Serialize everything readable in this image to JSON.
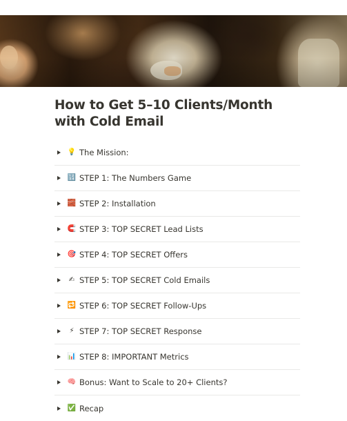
{
  "page": {
    "title": "How to Get 5–10 Clients/Month with Cold Email"
  },
  "colors": {
    "text": "#37352f",
    "divider": "#e9e9e7",
    "blue_box": "#3a78c9",
    "teal_box": "#2e8fd1",
    "green_box": "#3aa757",
    "bar_box": "#3a78c9"
  },
  "toggles": [
    {
      "icon": "lightbulb-icon",
      "glyph": "💡",
      "label": "The Mission:"
    },
    {
      "icon": "numbers-icon",
      "glyph": "🔢",
      "label": "STEP 1: The Numbers Game"
    },
    {
      "icon": "brick-icon",
      "glyph": "🧱",
      "label": "STEP 2: Installation"
    },
    {
      "icon": "magnet-icon",
      "glyph": "🧲",
      "label": "STEP 3: TOP SECRET Lead Lists"
    },
    {
      "icon": "target-icon",
      "glyph": "🎯",
      "label": "STEP 4: TOP SECRET Offers"
    },
    {
      "icon": "writing-hand-icon",
      "glyph": "✍",
      "label": "STEP 5: TOP SECRET Cold Emails"
    },
    {
      "icon": "repeat-icon",
      "glyph": "🔁",
      "label": "STEP 6: TOP SECRET Follow-Ups"
    },
    {
      "icon": "lightning-icon",
      "glyph": "⚡",
      "label": "STEP 7: TOP SECRET Response"
    },
    {
      "icon": "bar-chart-icon",
      "glyph": "📊",
      "label": "STEP 8: IMPORTANT Metrics"
    },
    {
      "icon": "brain-icon",
      "glyph": "🧠",
      "label": "Bonus: Want to Scale to 20+ Clients?"
    },
    {
      "icon": "check-mark-icon",
      "glyph": "✅",
      "label": "Recap"
    }
  ]
}
